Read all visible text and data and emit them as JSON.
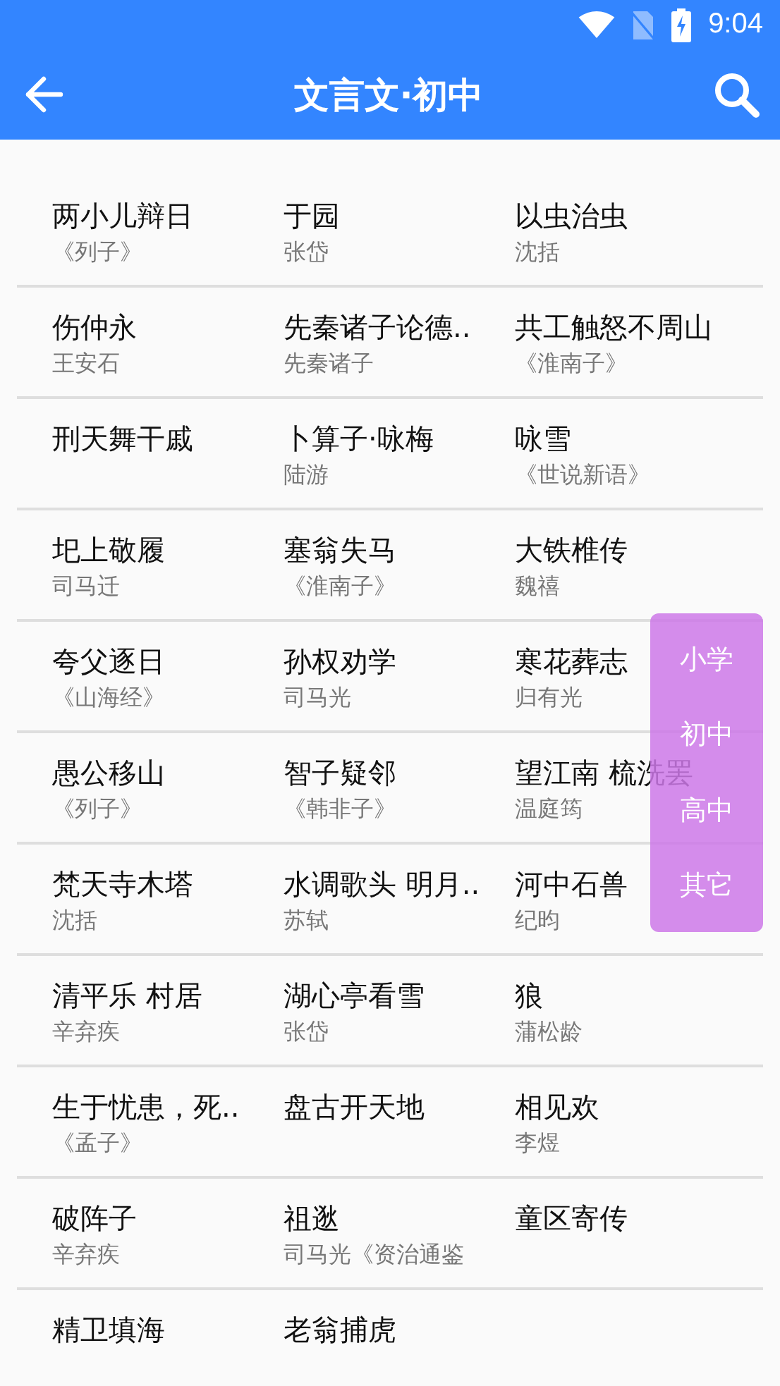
{
  "status_bar": {
    "time": "9:04"
  },
  "toolbar": {
    "title": "文言文·初中"
  },
  "rows": [
    [
      {
        "title": "两小儿辩日",
        "author": "《列子》"
      },
      {
        "title": "于园",
        "author": "张岱"
      },
      {
        "title": "以虫治虫",
        "author": "沈括"
      }
    ],
    [
      {
        "title": "伤仲永",
        "author": "王安石"
      },
      {
        "title": "先秦诸子论德..",
        "author": "先秦诸子"
      },
      {
        "title": "共工触怒不周山",
        "author": "《淮南子》"
      }
    ],
    [
      {
        "title": "刑天舞干戚"
      },
      {
        "title": "卜算子·咏梅",
        "author": "陆游"
      },
      {
        "title": "咏雪",
        "author": "《世说新语》"
      }
    ],
    [
      {
        "title": "圯上敬履",
        "author": "司马迁"
      },
      {
        "title": "塞翁失马",
        "author": "《淮南子》"
      },
      {
        "title": "大铁椎传",
        "author": "魏禧"
      }
    ],
    [
      {
        "title": "夸父逐日",
        "author": "《山海经》"
      },
      {
        "title": "孙权劝学",
        "author": "司马光"
      },
      {
        "title": "寒花葬志",
        "author": "归有光"
      }
    ],
    [
      {
        "title": "愚公移山",
        "author": "《列子》"
      },
      {
        "title": "智子疑邻",
        "author": "《韩非子》"
      },
      {
        "title": "望江南 梳洗罢",
        "author": "温庭筠"
      }
    ],
    [
      {
        "title": "梵天寺木塔",
        "author": "沈括"
      },
      {
        "title": "水调歌头 明月..",
        "author": "苏轼"
      },
      {
        "title": "河中石兽",
        "author": "纪昀"
      }
    ],
    [
      {
        "title": "清平乐 村居",
        "author": "辛弃疾"
      },
      {
        "title": "湖心亭看雪",
        "author": "张岱"
      },
      {
        "title": "狼",
        "author": "蒲松龄"
      }
    ],
    [
      {
        "title": "生于忧患，死..",
        "author": "《孟子》"
      },
      {
        "title": "盘古开天地"
      },
      {
        "title": "相见欢",
        "author": "李煜"
      }
    ],
    [
      {
        "title": "破阵子",
        "author": "辛弃疾"
      },
      {
        "title": "祖逖",
        "author": "司马光《资治通鉴"
      },
      {
        "title": "童区寄传"
      }
    ],
    [
      {
        "title": "精卫填海"
      },
      {
        "title": "老翁捕虎"
      }
    ]
  ],
  "level_menu": [
    "小学",
    "初中",
    "高中",
    "其它"
  ]
}
